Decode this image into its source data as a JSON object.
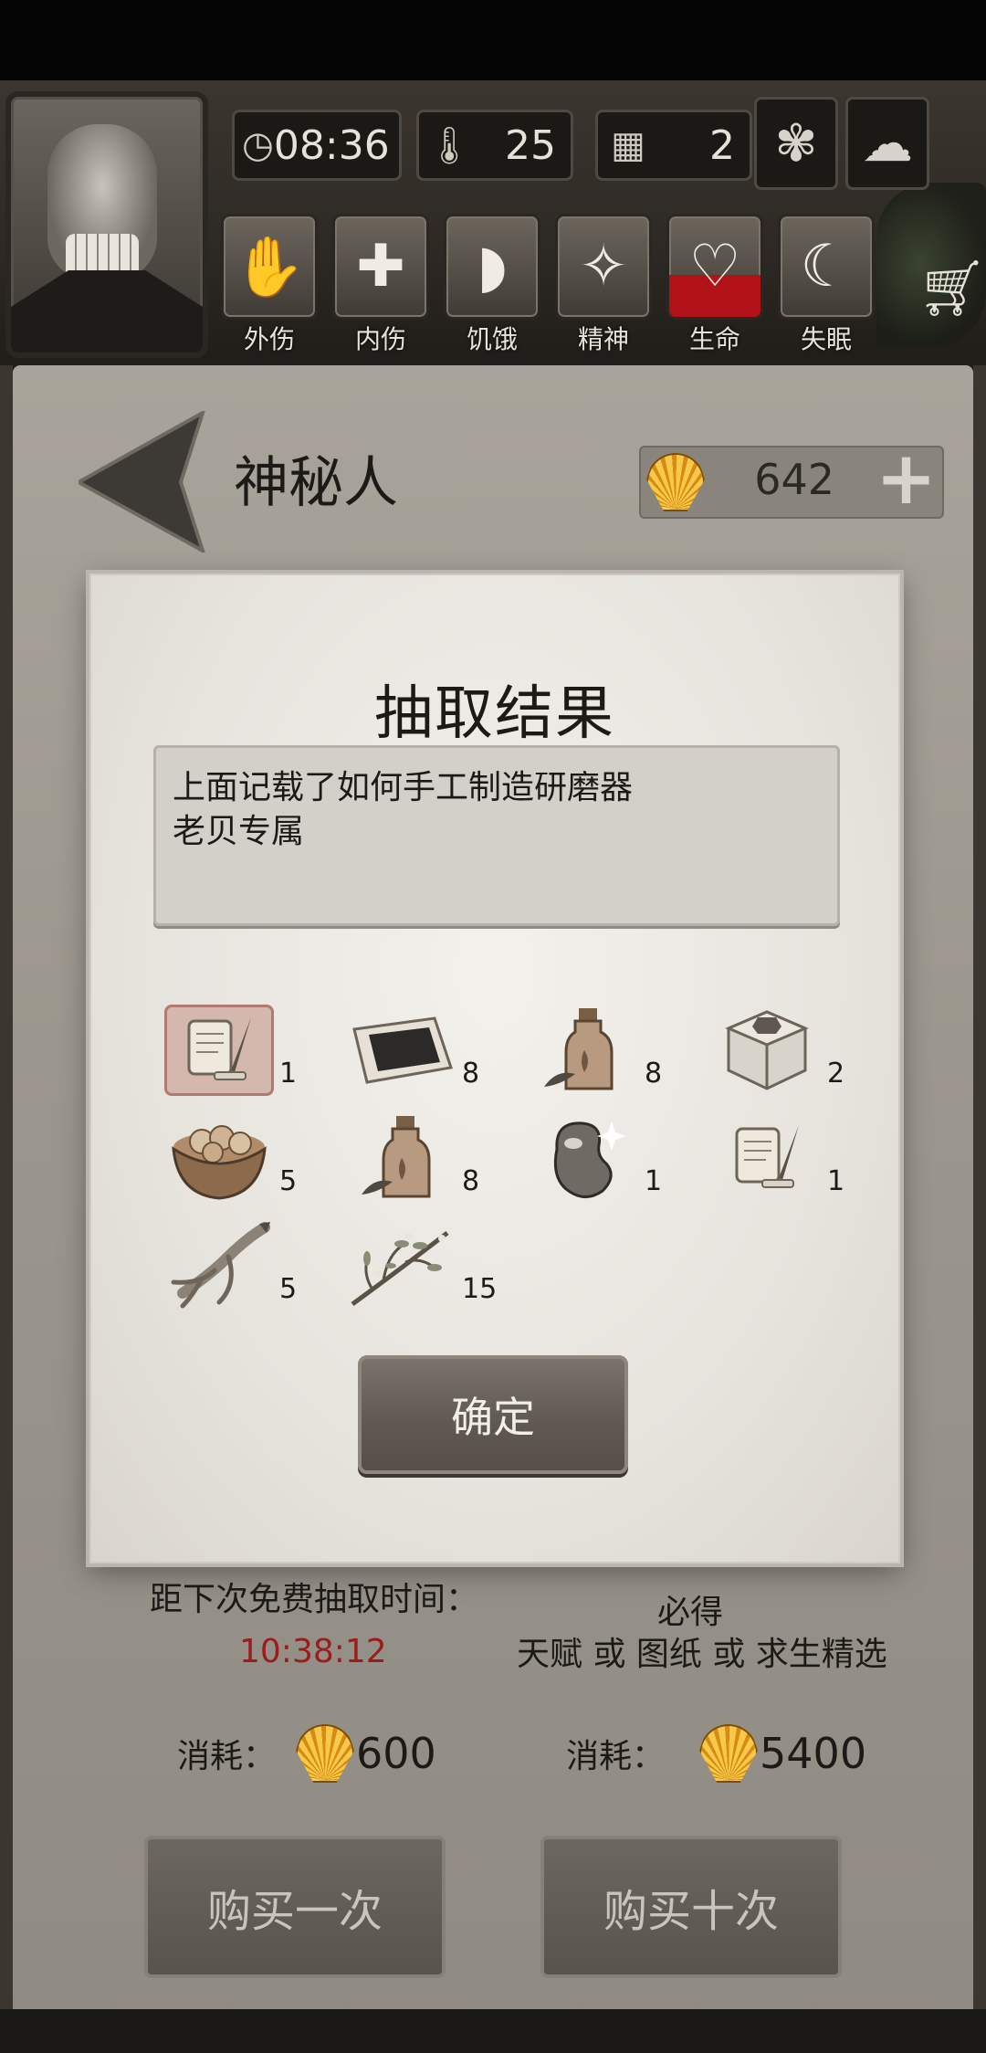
{
  "hud": {
    "time": "08:36",
    "temperature": "25",
    "day": "2",
    "statuses": [
      {
        "label": "外伤",
        "icon": "hand-wound-icon"
      },
      {
        "label": "内伤",
        "icon": "cross-icon"
      },
      {
        "label": "饥饿",
        "icon": "stomach-icon"
      },
      {
        "label": "精神",
        "icon": "mind-icon"
      },
      {
        "label": "生命",
        "icon": "heart-icon"
      },
      {
        "label": "失眠",
        "icon": "moon-star-icon"
      }
    ]
  },
  "header": {
    "title": "神秘人",
    "shells": "642"
  },
  "dialog": {
    "title": "抽取结果",
    "desc_line1": "上面记载了如何手工制造研磨器",
    "desc_line2": "老贝专属",
    "items": [
      {
        "icon": "blueprint-scroll-icon",
        "count": "1"
      },
      {
        "icon": "charcoal-sheet-icon",
        "count": "8"
      },
      {
        "icon": "herbal-bottle-icon",
        "count": "8"
      },
      {
        "icon": "metal-box-icon",
        "count": "2"
      },
      {
        "icon": "nut-bowl-icon",
        "count": "5"
      },
      {
        "icon": "herbal-bottle-icon",
        "count": "8"
      },
      {
        "icon": "shiny-bean-icon",
        "count": "1"
      },
      {
        "icon": "blueprint-scroll-icon",
        "count": "1"
      },
      {
        "icon": "ginseng-root-icon",
        "count": "5"
      },
      {
        "icon": "herb-branch-icon",
        "count": "15"
      }
    ],
    "confirm": "确定"
  },
  "footer": {
    "free_label": "距下次免费抽取时间：",
    "timer": "10:38:12",
    "guarantee_line1": "必得",
    "guarantee_line2": "天赋 或 图纸 或 求生精选",
    "cost_label": "消耗：",
    "cost_single": "600",
    "cost_ten": "5400",
    "buy_once": "购买一次",
    "buy_ten": "购买十次"
  },
  "colors": {
    "timer": "#9a1c1c",
    "life_red": "#b01217",
    "shell_gold": "#f6c94a"
  }
}
